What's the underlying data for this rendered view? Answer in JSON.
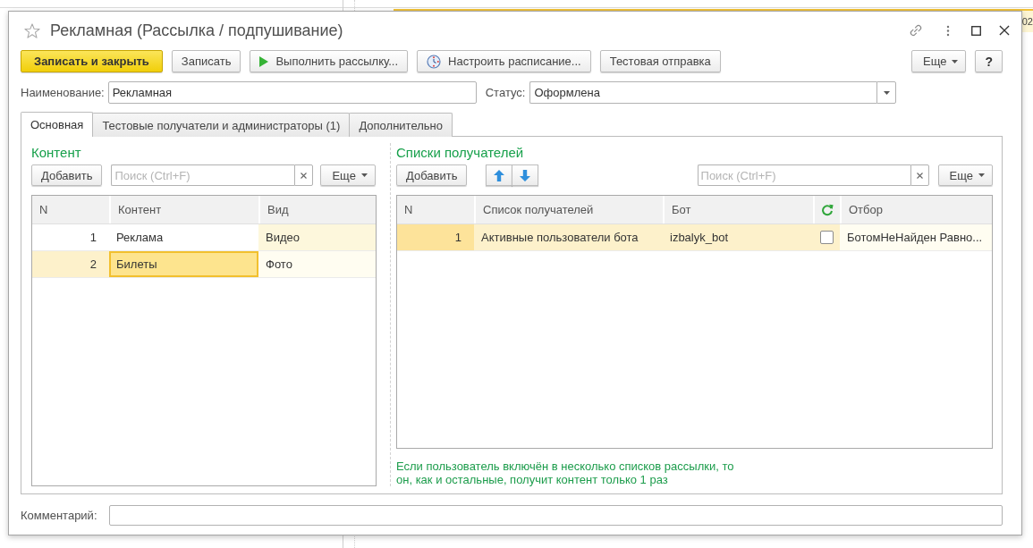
{
  "background": {
    "cut_text": "02"
  },
  "window": {
    "title": "Рекламная (Рассылка / подпушивание)",
    "favorite": false
  },
  "command_bar": {
    "buttons": [
      {
        "label": "Записать и закрыть",
        "kind": "default"
      },
      {
        "label": "Записать",
        "kind": "plain"
      },
      {
        "label": "Выполнить рассылку...",
        "kind": "run"
      },
      {
        "label": "Настроить расписание...",
        "kind": "schedule"
      },
      {
        "label": "Тестовая отправка",
        "kind": "plain"
      }
    ],
    "more": "Еще",
    "help": "?"
  },
  "name_field": {
    "label": "Наименование:",
    "value": "Рекламная"
  },
  "status_field": {
    "label": "Статус:",
    "value": "Оформлена"
  },
  "tabs": [
    {
      "label": "Основная",
      "selected": true
    },
    {
      "label": "Тестовые получатели и администраторы (1)",
      "selected": false
    },
    {
      "label": "Дополнительно",
      "selected": false
    }
  ],
  "content_group": {
    "title": "Контент",
    "add_button": "Добавить",
    "search": {
      "placeholder": "Поиск (Ctrl+F)"
    },
    "more": "Еще",
    "table": {
      "focused": true,
      "columns": [
        {
          "title": "N",
          "kind": "number",
          "tinted": false
        },
        {
          "title": "Контент",
          "kind": "text",
          "tinted": false
        },
        {
          "title": "Вид",
          "kind": "text",
          "tinted": true
        }
      ],
      "rows": [
        {
          "selected": false,
          "cells": [
            {
              "text": "1",
              "current": false
            },
            {
              "text": "Реклама",
              "current": false
            },
            {
              "text": "Видео",
              "current": false
            }
          ]
        },
        {
          "selected": true,
          "cells": [
            {
              "text": "2",
              "current": false
            },
            {
              "text": "Билеты",
              "current": true
            },
            {
              "text": "Фото",
              "current": false
            }
          ]
        }
      ]
    }
  },
  "recipients_group": {
    "title": "Списки получателей",
    "add_button": "Добавить",
    "search": {
      "placeholder": "Поиск (Ctrl+F)"
    },
    "more": "Еще",
    "table": {
      "focused": false,
      "columns": [
        {
          "title": "N",
          "kind": "number",
          "tinted": false
        },
        {
          "title": "Список получателей",
          "kind": "text",
          "tinted": false
        },
        {
          "title": "Бот",
          "kind": "text",
          "tinted": false
        },
        {
          "kind": "checkbox",
          "tinted": false
        },
        {
          "title": "Отбор",
          "kind": "text",
          "tinted": true
        }
      ],
      "rows": [
        {
          "selected": true,
          "cells": [
            {
              "text": "1",
              "current": true
            },
            {
              "text": "Активные пользователи бота",
              "current": false
            },
            {
              "text": "izbalyk_bot",
              "current": false
            },
            {
              "checked": false,
              "current": false
            },
            {
              "text": "БотомНеНайден Равно...",
              "current": false
            }
          ]
        }
      ]
    },
    "note": "Если пользователь включён в несколько списков рассылки, то он, как и остальные, получит контент только 1 раз"
  },
  "comment_field": {
    "label": "Комментарий:"
  }
}
